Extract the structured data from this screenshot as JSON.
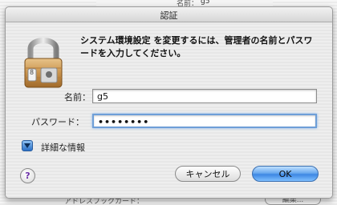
{
  "background": {
    "top_label": "名前：",
    "top_value": "g5",
    "bottom_text": "アドレスブックカード：",
    "bottom_button": "編集..."
  },
  "dialog": {
    "title": "認証",
    "message": "システム環境設定 を変更するには、管理者の名前とパスワードを入力してください。",
    "name_label": "名前：",
    "name_value": "g5",
    "password_label": "パスワード：",
    "password_value": "••••••••",
    "details_label": "詳細な情報",
    "help_glyph": "?",
    "cancel_label": "キャンセル",
    "ok_label": "OK",
    "lock_badge": "8"
  },
  "colors": {
    "accent": "#3d87e3",
    "focus_ring": "#6e9fd8"
  },
  "icons": {
    "lock": "padlock-icon",
    "disclosure": "disclosure-triangle-icon",
    "help": "help-icon"
  }
}
